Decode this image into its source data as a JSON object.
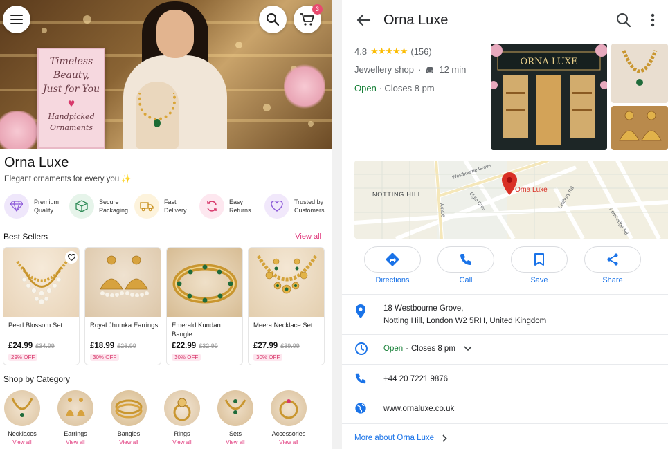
{
  "shop": {
    "hero_sign": {
      "line1": "Timeless",
      "line2": "Beauty,",
      "line3": "Just for You",
      "line4": "Handpicked",
      "line5": "Ornaments"
    },
    "cart_count": "3",
    "brand_name": "Orna Luxe",
    "tagline": "Elegant ornaments for every you ✨",
    "features": [
      {
        "line1": "Premium",
        "line2": "Quality",
        "icon": "diamond-icon",
        "bg": "#efe7fb",
        "color": "#8e5cd9"
      },
      {
        "line1": "Secure",
        "line2": "Packaging",
        "icon": "box-icon",
        "bg": "#e6f4ea",
        "color": "#2e8b57"
      },
      {
        "line1": "Fast",
        "line2": "Delivery",
        "icon": "truck-icon",
        "bg": "#fdf3dc",
        "color": "#c58a12"
      },
      {
        "line1": "Easy",
        "line2": "Returns",
        "icon": "refresh-icon",
        "bg": "#fde7ef",
        "color": "#d8386b"
      },
      {
        "line1": "Trusted by",
        "line2": "Customers",
        "icon": "heart-icon",
        "bg": "#f1e8fb",
        "color": "#8e5cd9"
      }
    ],
    "best_sellers_title": "Best Sellers",
    "view_all": "View all",
    "products": [
      {
        "name": "Pearl Blossom Set",
        "price": "£24.99",
        "was": "£34.99",
        "off": "29% OFF"
      },
      {
        "name": "Royal Jhumka Earrings",
        "price": "£18.99",
        "was": "£26.99",
        "off": "30% OFF"
      },
      {
        "name": "Emerald Kundan Bangle",
        "price": "£22.99",
        "was": "£32.99",
        "off": "30% OFF"
      },
      {
        "name": "Meera Necklace Set",
        "price": "£27.99",
        "was": "£39.99",
        "off": "30% OFF"
      }
    ],
    "category_title": "Shop by Category",
    "categories": [
      {
        "name": "Necklaces",
        "view": "View all"
      },
      {
        "name": "Earrings",
        "view": "View all"
      },
      {
        "name": "Bangles",
        "view": "View all"
      },
      {
        "name": "Rings",
        "view": "View all"
      },
      {
        "name": "Sets",
        "view": "View all"
      },
      {
        "name": "Accessories",
        "view": "View all"
      }
    ]
  },
  "maps": {
    "title": "Orna Luxe",
    "rating": "4.8",
    "stars": "★★★★★",
    "reviews": "(156)",
    "category": "Jewellery shop",
    "drive_time": "12 min",
    "open_status": "Open",
    "closes": "Closes 8 pm",
    "storefront_sign": "ORNA LUXE",
    "map": {
      "area_label": "NOTTING HILL",
      "pin_label": "Orna Luxe",
      "streets": [
        "Westbourne Grove",
        "A4206",
        "Elgin Cres",
        "Ledbury Rd",
        "Pembridge Rd"
      ]
    },
    "actions": [
      {
        "label": "Directions",
        "icon": "directions-icon"
      },
      {
        "label": "Call",
        "icon": "phone-icon"
      },
      {
        "label": "Save",
        "icon": "bookmark-icon"
      },
      {
        "label": "Share",
        "icon": "share-icon"
      }
    ],
    "address_line1": "18 Westbourne Grove,",
    "address_line2": "Notting Hill, London W2 5RH, United Kingdom",
    "hours_open": "Open",
    "hours_closes": "Closes 8 pm",
    "phone": "+44 20 7221 9876",
    "website": "www.ornaluxe.co.uk",
    "more_about": "More about Orna Luxe",
    "accent_color": "#1a73e8"
  }
}
